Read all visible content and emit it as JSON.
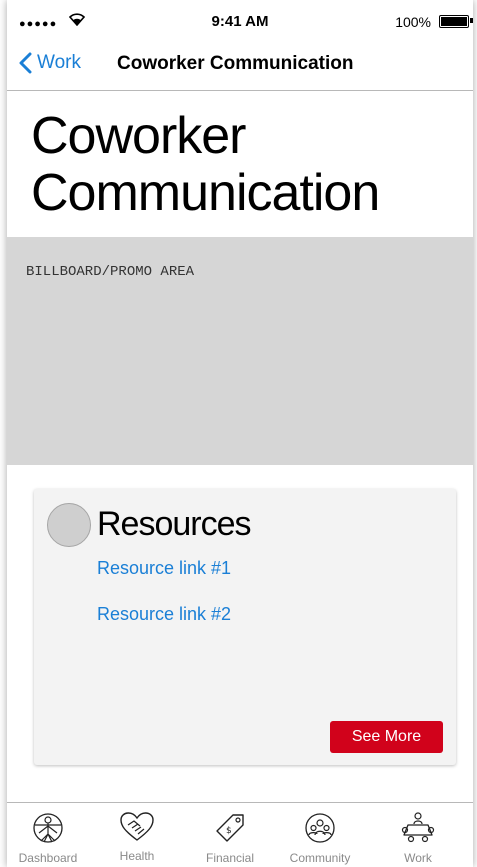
{
  "status_bar": {
    "signal": "●●●●●",
    "time": "9:41 AM",
    "battery": "100%"
  },
  "nav": {
    "back_label": "Work",
    "title": "Coworker Communication"
  },
  "page": {
    "title": "Coworker Communication"
  },
  "billboard": {
    "label": "BILLBOARD/PROMO AREA"
  },
  "resources": {
    "title": "Resources",
    "links": [
      "Resource link #1",
      "Resource link #2"
    ],
    "see_more": "See More"
  },
  "tabs": [
    {
      "label": "Dashboard",
      "icon": "vitruvian-man-icon"
    },
    {
      "label": "Health",
      "icon": "heart-handshake-icon"
    },
    {
      "label": "Financial",
      "icon": "price-tag-icon"
    },
    {
      "label": "Community",
      "icon": "people-circle-icon"
    },
    {
      "label": "Work",
      "icon": "meeting-table-icon"
    }
  ],
  "colors": {
    "link": "#1a7fd6",
    "accent_button": "#d1021b",
    "billboard": "#d6d6d6",
    "card": "#f3f3f3"
  }
}
